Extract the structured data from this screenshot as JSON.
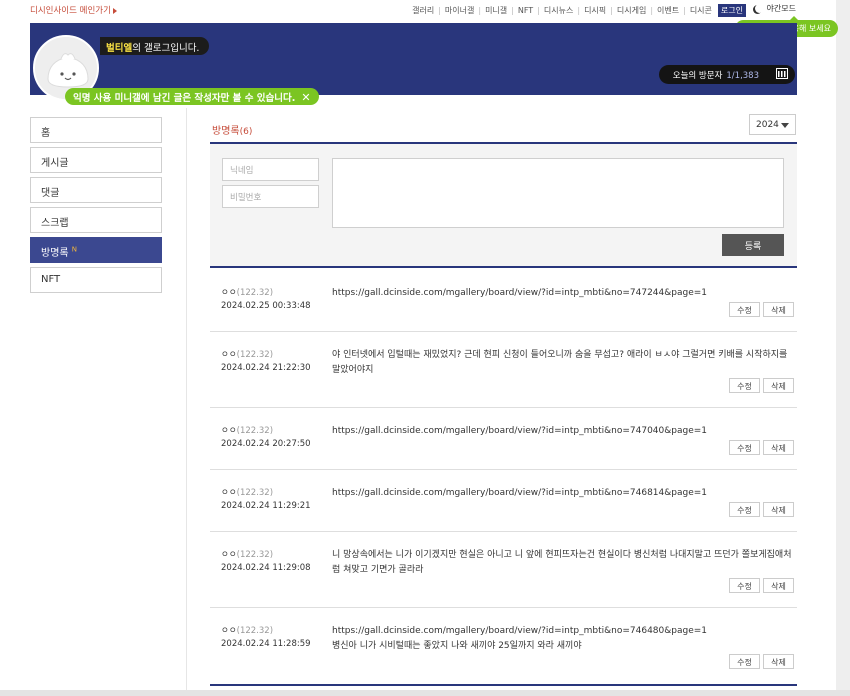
{
  "topbar": {
    "home_link": "디시인사이드 메인가기",
    "gnb": [
      "갤러리",
      "마이너갤",
      "미니갤",
      "NFT",
      "디시뉴스",
      "디시픽",
      "디시게임",
      "이벤트",
      "디시콘"
    ],
    "login": "로그인",
    "night_mode": "야간모드",
    "night_tip": "야간 모드를 이용해 보세요"
  },
  "banner": {
    "owner_nick": "벌티엘",
    "owner_suffix": "의 갤로그입니다.",
    "visitor_label": "오늘의 방문자",
    "visitor_count": "1/1,383",
    "notice": "익명 사용 미니갤에 남긴 글은 작성자만 볼 수 있습니다.",
    "notice_close": "✕"
  },
  "sidebar": {
    "items": [
      {
        "label": "홈"
      },
      {
        "label": "게시글"
      },
      {
        "label": "댓글"
      },
      {
        "label": "스크랩"
      },
      {
        "label": "방명록",
        "badge": "N"
      },
      {
        "label": "NFT"
      }
    ]
  },
  "guestbook": {
    "title": "방명록",
    "count": "(6)",
    "year": "2024",
    "nick_placeholder": "닉네임",
    "pw_placeholder": "비밀번호",
    "submit_label": "등록",
    "edit_label": "수정",
    "delete_label": "삭제",
    "entries": [
      {
        "nick": "ㅇㅇ",
        "ip": "(122.32)",
        "date": "2024.02.25 00:33:48",
        "text": "https://gall.dcinside.com/mgallery/board/view/?id=intp_mbti&no=747244&page=1"
      },
      {
        "nick": "ㅇㅇ",
        "ip": "(122.32)",
        "date": "2024.02.24 21:22:30",
        "text": "야 인터넷에서 입털때는 재밌었지? 근데 현피 신청이 들어오니까 숨을 무섭고? 애라이 ㅂㅅ야 그럴거면 키배를 시작하지를 말았어야지"
      },
      {
        "nick": "ㅇㅇ",
        "ip": "(122.32)",
        "date": "2024.02.24 20:27:50",
        "text": "https://gall.dcinside.com/mgallery/board/view/?id=intp_mbti&no=747040&page=1"
      },
      {
        "nick": "ㅇㅇ",
        "ip": "(122.32)",
        "date": "2024.02.24 11:29:21",
        "text": "https://gall.dcinside.com/mgallery/board/view/?id=intp_mbti&no=746814&page=1"
      },
      {
        "nick": "ㅇㅇ",
        "ip": "(122.32)",
        "date": "2024.02.24 11:29:08",
        "text": "니 망상속에서는 니가 이기겠지만 현실은 아니고 니 앞에 현피뜨자는건 현실이다 병신처럼 나대지말고 뜨던가 쫄보게집애처럼 쳐맞고 기면가 골라라"
      },
      {
        "nick": "ㅇㅇ",
        "ip": "(122.32)",
        "date": "2024.02.24 11:28:59",
        "text": "https://gall.dcinside.com/mgallery/board/view/?id=intp_mbti&no=746480&page=1\n병신아 니가 시비털때는 좋았지 나와 새끼야 25일까지 와라 새끼야"
      }
    ]
  },
  "colors": {
    "brand": "#29367c",
    "accent_green": "#7bc522",
    "accent_red": "#c64c3a"
  }
}
